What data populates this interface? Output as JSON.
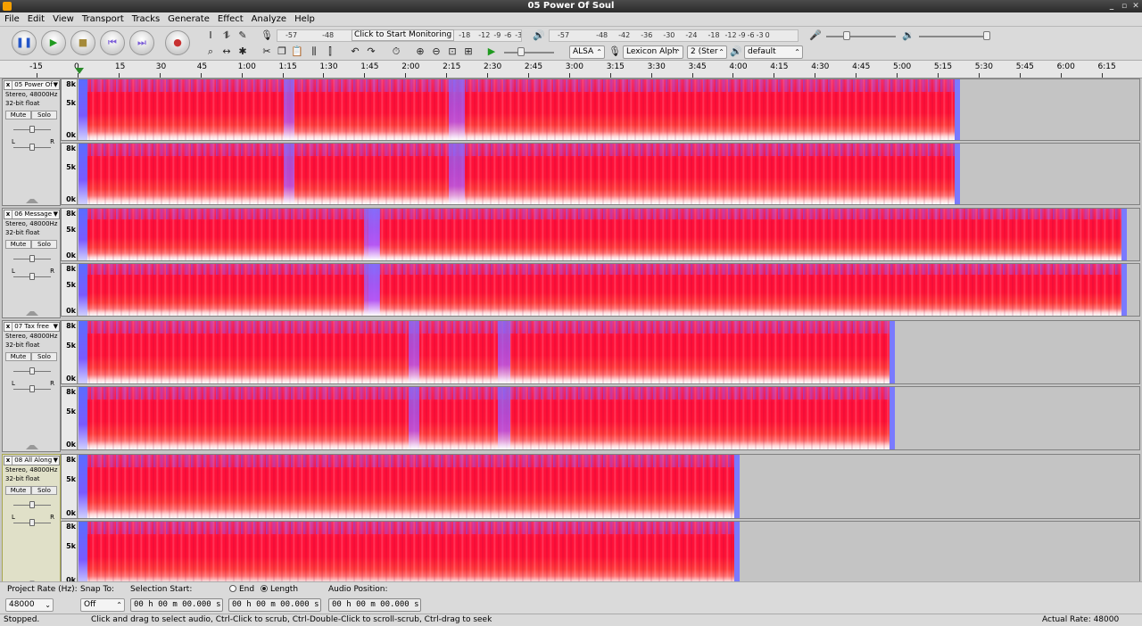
{
  "window": {
    "title": "05 Power Of Soul"
  },
  "menu": [
    "File",
    "Edit",
    "View",
    "Transport",
    "Tracks",
    "Generate",
    "Effect",
    "Analyze",
    "Help"
  ],
  "toolbar": {
    "monitor_label": "Click to Start Monitoring",
    "record_meter_ticks": [
      "-57",
      "-48",
      "-18",
      "-12",
      "-9",
      "-6",
      "-3",
      "0"
    ],
    "play_meter_ticks": [
      "-57",
      "-48",
      "-42",
      "-36",
      "-30",
      "-24",
      "-18",
      "-12",
      "-9",
      "-6",
      "-3",
      "0"
    ],
    "audio_host": "ALSA",
    "recording_device": "Lexicon Alph",
    "channels": "2 (Ster",
    "playback_device": "default"
  },
  "ruler": {
    "labels": [
      "-15",
      "0",
      "15",
      "30",
      "45",
      "1:00",
      "1:15",
      "1:30",
      "1:45",
      "2:00",
      "2:15",
      "2:30",
      "2:45",
      "3:00",
      "3:15",
      "3:30",
      "3:45",
      "4:00",
      "4:15",
      "4:30",
      "4:45",
      "5:00",
      "5:15",
      "5:30",
      "5:45",
      "6:00",
      "6:15"
    ]
  },
  "track_common": {
    "format": "Stereo, 48000Hz",
    "bitdepth": "32-bit float",
    "mute": "Mute",
    "solo": "Solo",
    "left": "L",
    "right": "R",
    "close": "x",
    "scale_top": "8k",
    "scale_mid": "5k",
    "scale_bot": "0k"
  },
  "tracks": [
    {
      "name": "05 Power Of",
      "length_seconds": 323,
      "selected": false
    },
    {
      "name": "06 Message",
      "length_seconds": 384,
      "selected": false
    },
    {
      "name": "07 Tax free",
      "length_seconds": 299,
      "selected": false
    },
    {
      "name": "08 All Along",
      "length_seconds": 242,
      "selected": true
    }
  ],
  "selection": {
    "project_rate_label": "Project Rate (Hz):",
    "project_rate": "48000",
    "snap_to_label": "Snap To:",
    "snap_to": "Off",
    "selection_start_label": "Selection Start:",
    "selection_start": "00 h 00 m 00.000 s",
    "end_label": "End",
    "length_label": "Length",
    "length_value": "00 h 00 m 00.000 s",
    "audio_position_label": "Audio Position:",
    "audio_position": "00 h 00 m 00.000 s"
  },
  "status": {
    "state": "Stopped.",
    "hint": "Click and drag to select audio, Ctrl-Click to scrub, Ctrl-Double-Click to scroll-scrub, Ctrl-drag to seek",
    "actual_rate": "Actual Rate: 48000"
  }
}
